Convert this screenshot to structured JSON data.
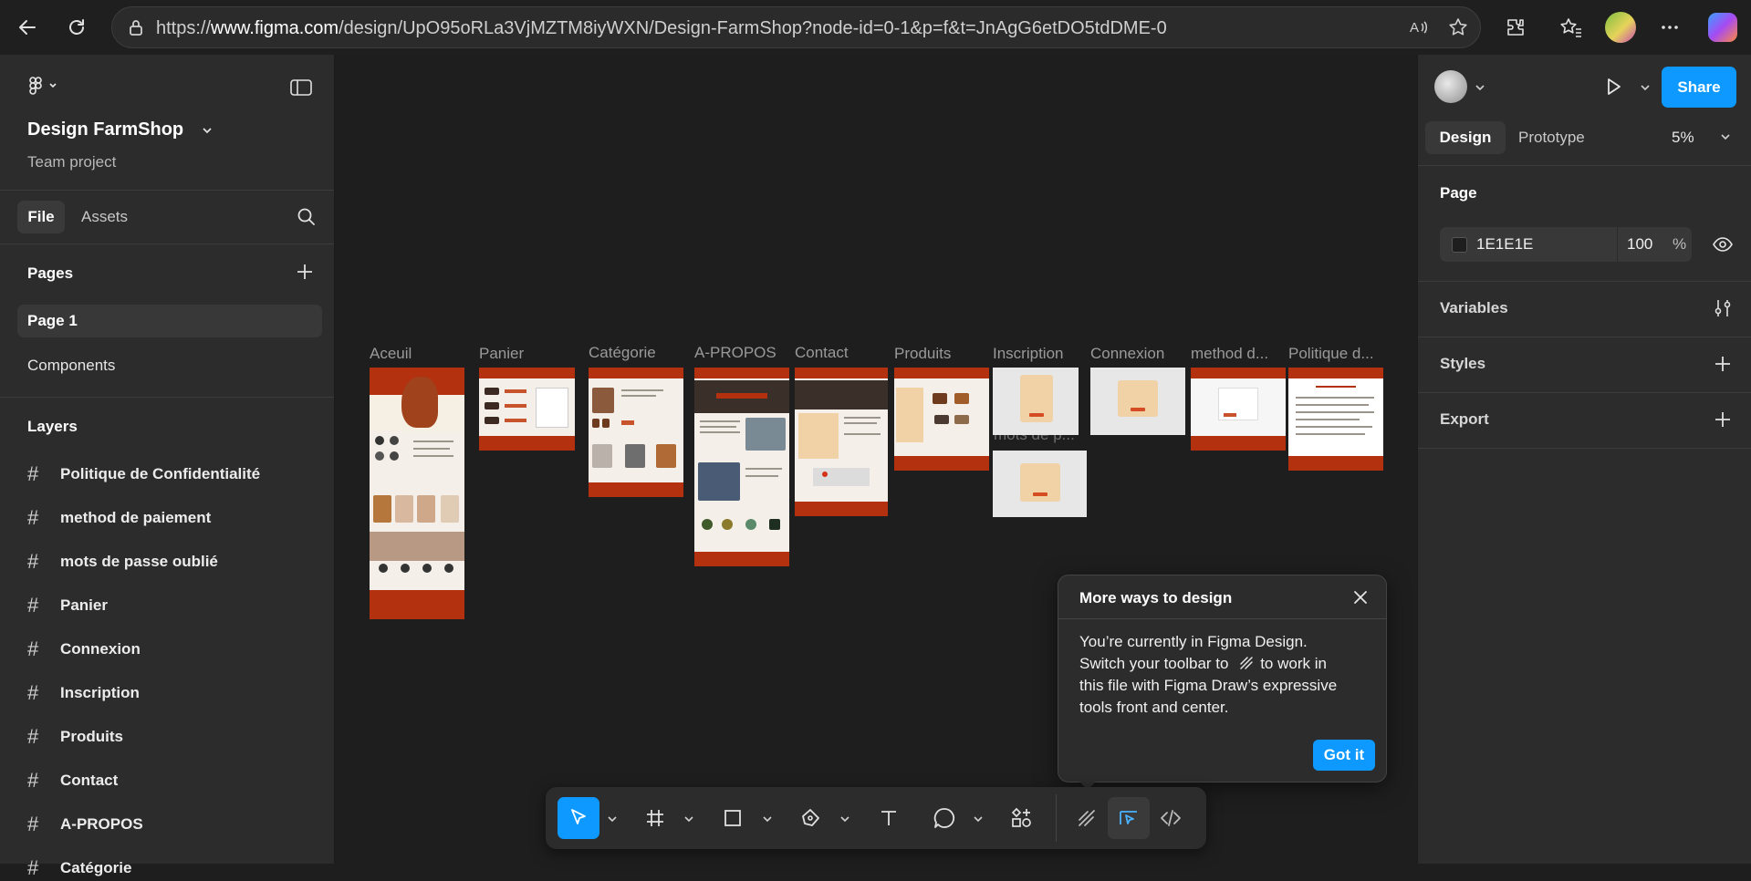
{
  "browser": {
    "url_prefix": "https://",
    "url_host": "www.figma.com",
    "url_path": "/design/UpO95oRLa3VjMZTM8iyWXN/Design-FarmShop?node-id=0-1&p=f&t=JnAgG6etDO5tdDME-0"
  },
  "project": {
    "name": "Design FarmShop",
    "subtitle": "Team project"
  },
  "left_tabs": {
    "file": "File",
    "assets": "Assets"
  },
  "pages": {
    "heading": "Pages",
    "items": [
      "Page 1",
      "Components"
    ]
  },
  "layers": {
    "heading": "Layers",
    "items": [
      "Politique de Confidentialité",
      "method de paiement",
      "mots de passe oublié",
      "Panier",
      "Connexion",
      "Inscription",
      "Produits",
      "Contact",
      "A-PROPOS",
      "Catégorie"
    ]
  },
  "canvas": {
    "frames": [
      "Aceuil",
      "Panier",
      "Catégorie",
      "A-PROPOS",
      "Contact",
      "Produits",
      "Inscription",
      "Connexion",
      "method d...",
      "Politique d...",
      "mots de p..."
    ]
  },
  "right": {
    "share": "Share",
    "tabs": {
      "design": "Design",
      "prototype": "Prototype"
    },
    "zoom": "5%",
    "page_heading": "Page",
    "bg_hex": "1E1E1E",
    "bg_opacity": "100",
    "pct": "%",
    "variables": "Variables",
    "styles": "Styles",
    "export": "Export"
  },
  "tooltip": {
    "title": "More ways to design",
    "line1": "You’re currently in Figma Design.",
    "line2a": "Switch your toolbar to",
    "line2b": "to work in",
    "line3": "this file with Figma Draw’s expressive",
    "line4": "tools front and center.",
    "button": "Got it"
  },
  "help": "?",
  "colors": {
    "accent": "#0d99ff",
    "frame_header": "#b3310f",
    "canvas": "#1e1e1e"
  },
  "icons": [
    "back-icon",
    "refresh-icon",
    "lock-icon",
    "read-aloud-icon",
    "favorite-icon",
    "extensions-icon",
    "favorites-icon",
    "more-icon",
    "copilot-icon",
    "figma-logo-icon",
    "sidebar-toggle-icon",
    "search-icon",
    "plus-icon",
    "play-icon",
    "eye-icon",
    "variables-icon",
    "close-icon",
    "move-tool-icon",
    "frame-tool-icon",
    "rectangle-tool-icon",
    "pen-tool-icon",
    "text-tool-icon",
    "comment-tool-icon",
    "actions-icon",
    "draw-mode-icon",
    "design-mode-icon",
    "dev-mode-icon"
  ]
}
